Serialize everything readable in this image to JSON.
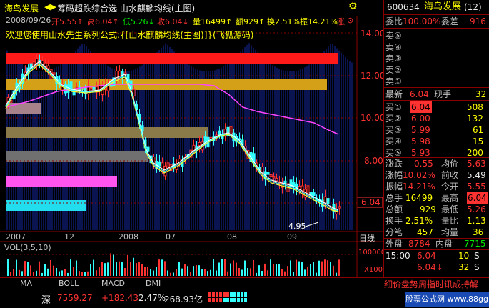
{
  "header": {
    "stock_name": "海鸟发展",
    "title_text": "筹码超跌综合选  山水麒麟均线(主图)",
    "gear_glyph": "⚙",
    "arrows_glyph": "◀▶"
  },
  "quote": {
    "date": "2008/09/26",
    "open": "开5.55↑",
    "high": "高6.04↑",
    "low": "低5.26↓",
    "close": "收6.04↓",
    "volume": "量16499↑",
    "amount": "额929↑",
    "turnover": "换2.51%",
    "amplitude": "振14.21%",
    "limit": "涨",
    "limit_icon": "⊙"
  },
  "welcome": "欢迎您使用山水先生系列公式:{[山水麒麟均线(主图)]}(飞狐源码)",
  "price_axis": [
    "14.00",
    "12.00",
    "10.00",
    "8.00",
    "6.04"
  ],
  "price_tag": "6.04",
  "low_marker": "4.95",
  "date_axis": [
    "2007",
    "12",
    "2008",
    "07",
    "08",
    "09"
  ],
  "date_axis_end": "日线",
  "vol": {
    "label": "VOL(3,5,10)",
    "axis": [
      "100000",
      "X100"
    ]
  },
  "right": {
    "code": "600634",
    "name": "海鸟发展",
    "num": "(12)",
    "weibi_label": "委比",
    "weibi_value": "100.00%",
    "weicha_label": "委差",
    "weicha_value": "916",
    "sell": [
      "卖⑤",
      "卖④",
      "卖③",
      "卖②",
      "卖①"
    ],
    "last_label": "最新",
    "last_value": "6.04",
    "hand_label": "现手",
    "hand_value": "32",
    "buy": [
      {
        "label": "买①",
        "price": "6.04",
        "vol": "508"
      },
      {
        "label": "买②",
        "price": "6.00",
        "vol": "132"
      },
      {
        "label": "买③",
        "price": "5.99",
        "vol": "61"
      },
      {
        "label": "买④",
        "price": "5.98",
        "vol": "15"
      },
      {
        "label": "买⑤",
        "price": "5.93",
        "vol": "200"
      }
    ],
    "stats": [
      {
        "l1": "涨跌",
        "v1": "0.55",
        "l2": "均价",
        "v2": "5.63"
      },
      {
        "l1": "涨幅",
        "v1": "10.02%",
        "l2": "前收",
        "v2": "5.49"
      },
      {
        "l1": "振幅",
        "v1": "14.21%",
        "l2": "今开",
        "v2": "5.55"
      },
      {
        "l1": "总手",
        "v1": "16499",
        "l2": "最高",
        "v2": "6.04"
      },
      {
        "l1": "总额",
        "v1": "929",
        "l2": "最低",
        "v2": "5.26"
      },
      {
        "l1": "换手",
        "v1": "2.51%",
        "l2": "量比",
        "v2": "1.13"
      },
      {
        "l1": "分笔",
        "v1": "457",
        "l2": "均量",
        "v2": "36"
      }
    ],
    "outer_label": "外盘",
    "outer_value": "8784",
    "inner_label": "内盘",
    "inner_value": "7715",
    "tick": {
      "time": "15:00",
      "price": "6.04",
      "vol": "10",
      "flag": "S"
    },
    "tick2": {
      "time": "",
      "price": "6.04↓",
      "vol": "32",
      "flag": "S"
    },
    "bottom_tabs": "细价盘势周指时讯成持解"
  },
  "tabs": [
    "MA",
    "BOLL",
    "MACD",
    "DMI"
  ],
  "status": {
    "market": "深",
    "index": "7559.27",
    "change": "+182.43",
    "pct": "2.47%",
    "amount": "268.93亿",
    "site": "股票公式网 www.88gg.com"
  }
}
